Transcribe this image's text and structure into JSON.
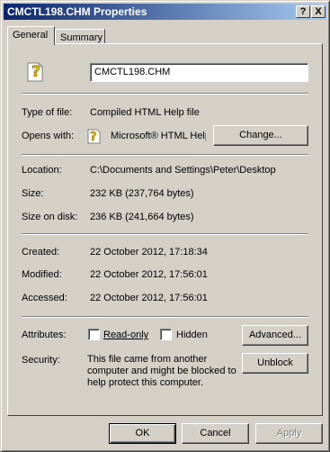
{
  "window": {
    "title": "CMCTL198.CHM Properties"
  },
  "titlebar_buttons": {
    "help": "?",
    "close": "X"
  },
  "tabs": [
    {
      "label": "General",
      "selected": true
    },
    {
      "label": "Summary",
      "selected": false
    }
  ],
  "general": {
    "file_icon": "chm-file-icon",
    "filename": "CMCTL198.CHM",
    "type_label": "Type of file:",
    "type_value": "Compiled HTML Help file",
    "opens_label": "Opens with:",
    "opens_value": "Microsoft® HTML Help",
    "change_button": "Change...",
    "location_label": "Location:",
    "location_value": "C:\\Documents and Settings\\Peter\\Desktop",
    "size_label": "Size:",
    "size_value": "232 KB (237,764 bytes)",
    "size_on_disk_label": "Size on disk:",
    "size_on_disk_value": "236 KB (241,664 bytes)",
    "created_label": "Created:",
    "created_value": "22 October 2012, 17:18:34",
    "modified_label": "Modified:",
    "modified_value": "22 October 2012, 17:56:01",
    "accessed_label": "Accessed:",
    "accessed_value": "22 October 2012, 17:56:01",
    "attributes_label": "Attributes:",
    "readonly_label": "Read-only",
    "readonly_checked": false,
    "hidden_label": "Hidden",
    "hidden_checked": false,
    "advanced_button": "Advanced...",
    "security_label": "Security:",
    "security_text": "This file came from another computer and might be blocked to help protect this computer.",
    "unblock_button": "Unblock"
  },
  "footer": {
    "ok": "OK",
    "cancel": "Cancel",
    "apply": "Apply"
  }
}
